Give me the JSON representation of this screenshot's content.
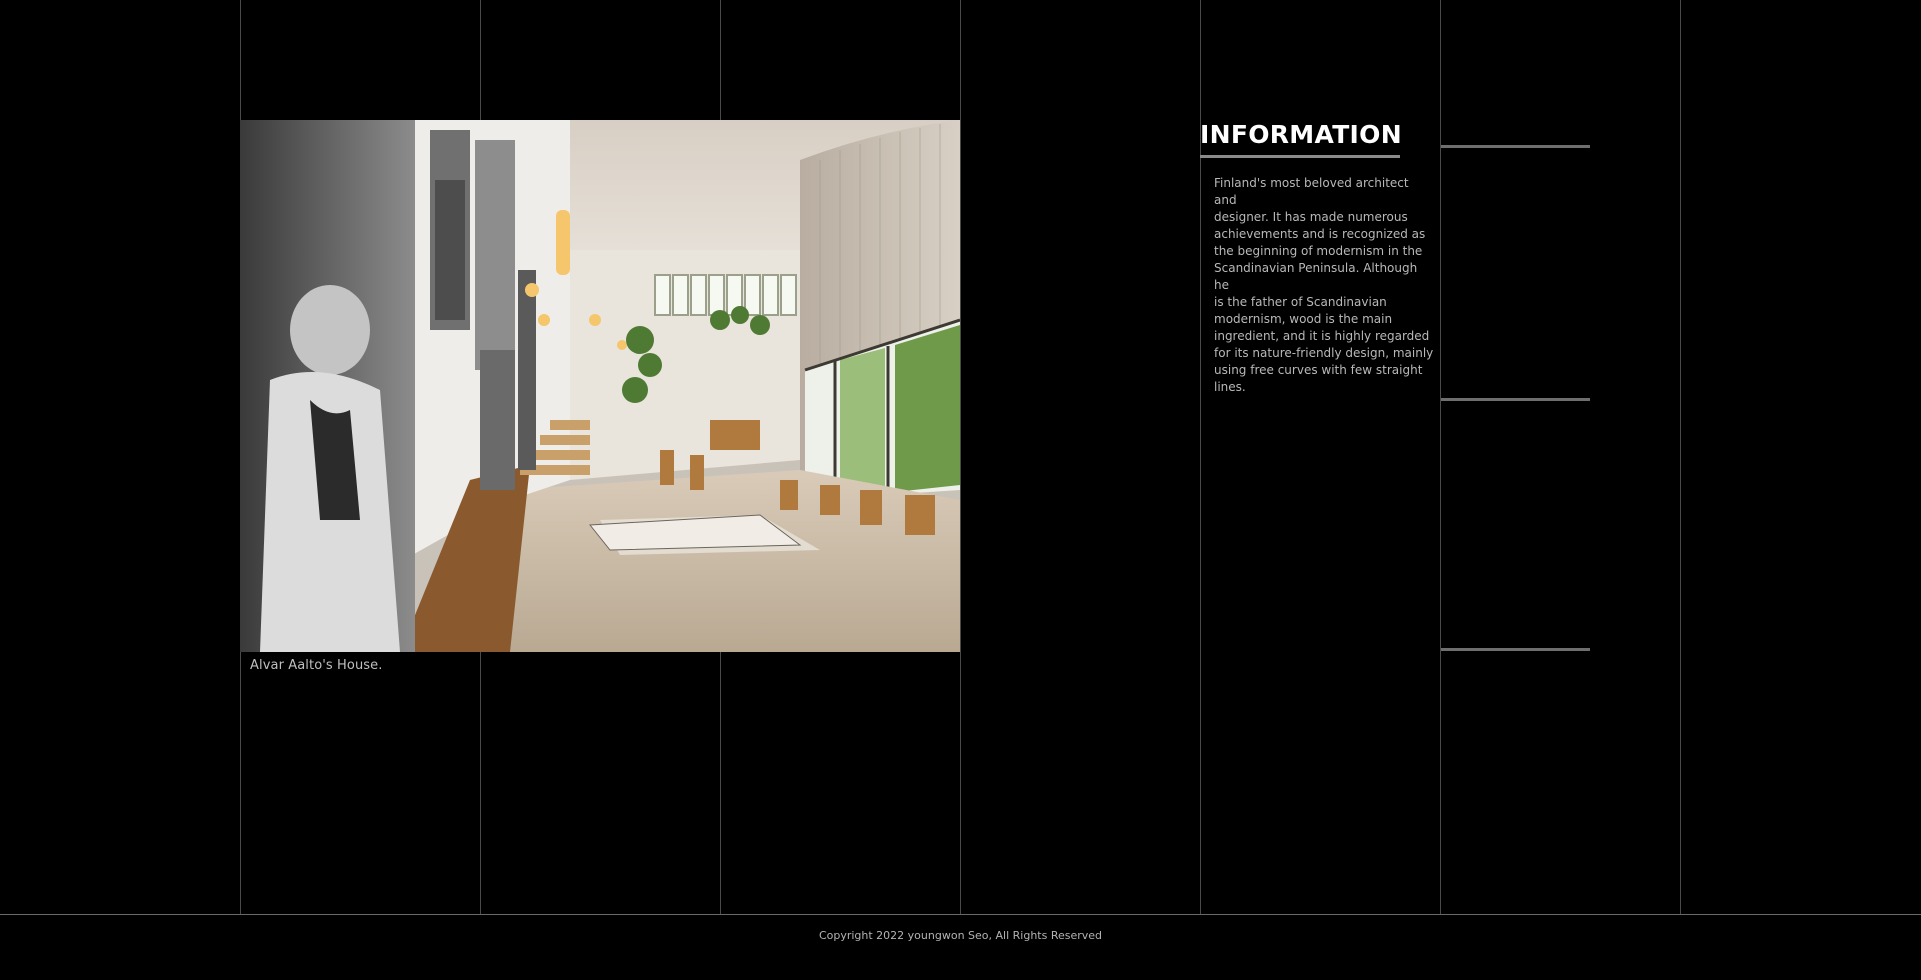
{
  "gallery": {
    "caption": "Alvar Aalto's House."
  },
  "information": {
    "title": "INFORMATION",
    "body": " Finland's most beloved architect and\ndesigner. It has made numerous\nachievements and is recognized as\nthe beginning of modernism in the\nScandinavian Peninsula. Although he\nis the father of Scandinavian\nmodernism, wood is the main\ningredient, and it is highly regarded\nfor its nature-friendly design, mainly\nusing free curves with few straight\nlines."
  },
  "footer": {
    "copyright": "Copyright 2022 youngwon Seo, All Rights Reserved"
  },
  "colors": {
    "background": "#000000",
    "grid_line": "#4a4a4a",
    "text_primary": "#ffffff",
    "text_secondary": "#b8b8b8"
  }
}
